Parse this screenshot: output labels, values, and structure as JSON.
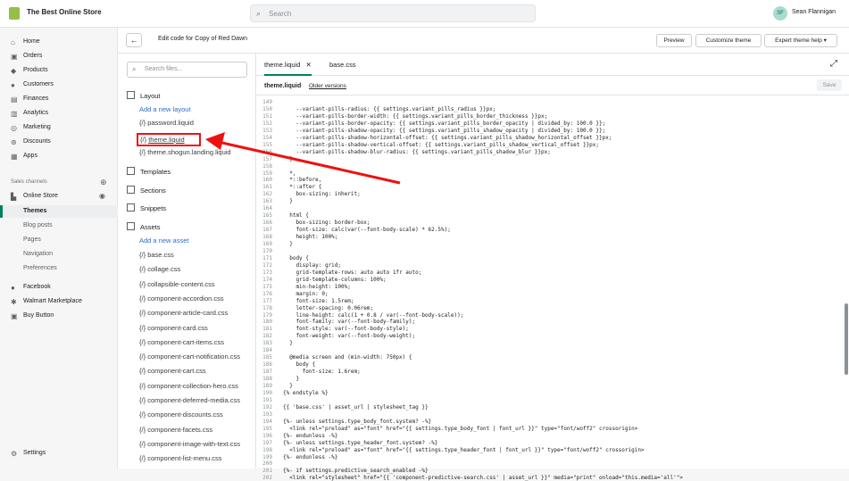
{
  "topbar": {
    "store_name": "The Best Online Store",
    "search_placeholder": "Search",
    "avatar": "SF",
    "user_name": "Sean Flannigan"
  },
  "nav": {
    "items": [
      "Home",
      "Orders",
      "Products",
      "Customers",
      "Finances",
      "Analytics",
      "Marketing",
      "Discounts",
      "Apps"
    ],
    "channels_label": "Sales channels",
    "online_store": "Online Store",
    "sub": [
      "Themes",
      "Blog posts",
      "Pages",
      "Navigation",
      "Preferences"
    ],
    "apps": [
      "Facebook",
      "Walmart Marketplace",
      "Buy Button"
    ],
    "settings": "Settings"
  },
  "header": {
    "edit_prefix": "Edit code for",
    "theme": "Copy of Red Dawn",
    "preview": "Preview",
    "customize": "Customize theme",
    "expert": "Expert theme help"
  },
  "files": {
    "search_placeholder": "Search files...",
    "layout": "Layout",
    "add_layout": "Add a new layout",
    "layout_files": [
      "password.liquid",
      "theme.liquid",
      "theme.shogun.landing.liquid"
    ],
    "templates": "Templates",
    "sections": "Sections",
    "snippets": "Snippets",
    "assets": "Assets",
    "add_asset": "Add a new asset",
    "asset_files": [
      "base.css",
      "collage.css",
      "collapsible-content.css",
      "component-accordion.css",
      "component-article-card.css",
      "component-card.css",
      "component-cart-items.css",
      "component-cart-notification.css",
      "component-cart.css",
      "component-collection-hero.css",
      "component-deferred-media.css",
      "component-discounts.css",
      "component-facets.css",
      "component-image-with-text.css",
      "component-list-menu.css"
    ]
  },
  "editor": {
    "tab1": "theme.liquid",
    "tab2": "base.css",
    "file": "theme.liquid",
    "older": "Older versions",
    "save": "Save",
    "lines": [
      [
        "149",
        ""
      ],
      [
        "150",
        "    --variant-pills-radius: {{ settings.variant_pills_radius }}px;"
      ],
      [
        "151",
        "    --variant-pills-border-width: {{ settings.variant_pills_border_thickness }}px;"
      ],
      [
        "152",
        "    --variant-pills-border-opacity: {{ settings.variant_pills_border_opacity | divided_by: 100.0 }};"
      ],
      [
        "153",
        "    --variant-pills-shadow-opacity: {{ settings.variant_pills_shadow_opacity | divided_by: 100.0 }};"
      ],
      [
        "154",
        "    --variant-pills-shadow-horizontal-offset: {{ settings.variant_pills_shadow_horizontal_offset }}px;"
      ],
      [
        "155",
        "    --variant-pills-shadow-vertical-offset: {{ settings.variant_pills_shadow_vertical_offset }}px;"
      ],
      [
        "156",
        "    --variant-pills-shadow-blur-radius: {{ settings.variant_pills_shadow_blur }}px;"
      ],
      [
        "157",
        "  }"
      ],
      [
        "158",
        ""
      ],
      [
        "159",
        "  *,"
      ],
      [
        "160",
        "  *::before,"
      ],
      [
        "161",
        "  *::after {"
      ],
      [
        "162",
        "    box-sizing: inherit;"
      ],
      [
        "163",
        "  }"
      ],
      [
        "164",
        ""
      ],
      [
        "165",
        "  html {"
      ],
      [
        "166",
        "    box-sizing: border-box;"
      ],
      [
        "167",
        "    font-size: calc(var(--font-body-scale) * 62.5%);"
      ],
      [
        "168",
        "    height: 100%;"
      ],
      [
        "169",
        "  }"
      ],
      [
        "170",
        ""
      ],
      [
        "171",
        "  body {"
      ],
      [
        "172",
        "    display: grid;"
      ],
      [
        "173",
        "    grid-template-rows: auto auto 1fr auto;"
      ],
      [
        "174",
        "    grid-template-columns: 100%;"
      ],
      [
        "175",
        "    min-height: 100%;"
      ],
      [
        "176",
        "    margin: 0;"
      ],
      [
        "177",
        "    font-size: 1.5rem;"
      ],
      [
        "178",
        "    letter-spacing: 0.06rem;"
      ],
      [
        "179",
        "    line-height: calc(1 + 0.8 / var(--font-body-scale));"
      ],
      [
        "180",
        "    font-family: var(--font-body-family);"
      ],
      [
        "181",
        "    font-style: var(--font-body-style);"
      ],
      [
        "182",
        "    font-weight: var(--font-body-weight);"
      ],
      [
        "183",
        "  }"
      ],
      [
        "184",
        ""
      ],
      [
        "185",
        "  @media screen and (min-width: 750px) {"
      ],
      [
        "186",
        "    body {"
      ],
      [
        "187",
        "      font-size: 1.6rem;"
      ],
      [
        "188",
        "    }"
      ],
      [
        "189",
        "  }"
      ],
      [
        "190",
        "{% endstyle %}"
      ],
      [
        "191",
        ""
      ],
      [
        "192",
        "{{ 'base.css' | asset_url | stylesheet_tag }}"
      ],
      [
        "193",
        ""
      ],
      [
        "194",
        "{%- unless settings.type_body_font.system? -%}"
      ],
      [
        "195",
        "  <link rel=\"preload\" as=\"font\" href=\"{{ settings.type_body_font | font_url }}\" type=\"font/woff2\" crossorigin>"
      ],
      [
        "196",
        "{%- endunless -%}"
      ],
      [
        "197",
        "{%- unless settings.type_header_font.system? -%}"
      ],
      [
        "198",
        "  <link rel=\"preload\" as=\"font\" href=\"{{ settings.type_header_font | font_url }}\" type=\"font/woff2\" crossorigin>"
      ],
      [
        "199",
        "{%- endunless -%}"
      ],
      [
        "200",
        ""
      ],
      [
        "201",
        "{%- if settings.predictive_search_enabled -%}"
      ],
      [
        "202",
        "  <link rel=\"stylesheet\" href=\"{{ 'component-predictive-search.css' | asset_url }}\" media=\"print\" onload=\"this.media='all'\">"
      ]
    ]
  }
}
